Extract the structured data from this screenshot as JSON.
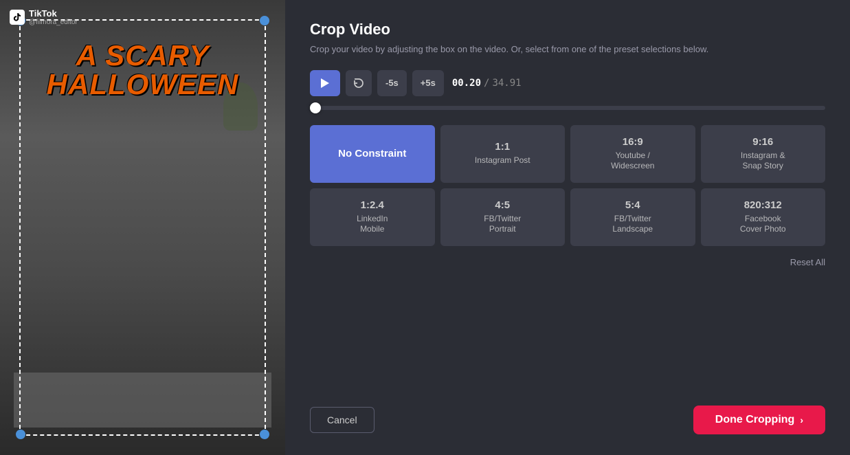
{
  "app": {
    "tiktok_name": "TikTok",
    "tiktok_handle": "@filmora_editor"
  },
  "halloween_title": "A SCARY",
  "halloween_subtitle": "HALLOWEEN",
  "panel": {
    "title": "Crop Video",
    "subtitle": "Crop your video by adjusting the box on the video. Or, select from one of the preset\nselections below."
  },
  "controls": {
    "minus5": "-5s",
    "plus5": "+5s",
    "current_time": "00.20",
    "separator": "/",
    "total_time": "34.91"
  },
  "presets": [
    {
      "ratio": "No Constraint",
      "label": "",
      "active": true
    },
    {
      "ratio": "1:1",
      "label": "Instagram Post",
      "active": false
    },
    {
      "ratio": "16:9",
      "label": "Youtube /\nWidescreen",
      "active": false
    },
    {
      "ratio": "9:16",
      "label": "Instagram &\nSnap Story",
      "active": false
    },
    {
      "ratio": "1:2.4",
      "label": "LinkedIn\nMobile",
      "active": false
    },
    {
      "ratio": "4:5",
      "label": "FB/Twitter\nPortrait",
      "active": false
    },
    {
      "ratio": "5:4",
      "label": "FB/Twitter\nLandscape",
      "active": false
    },
    {
      "ratio": "820:312",
      "label": "Facebook\nCover Photo",
      "active": false
    }
  ],
  "buttons": {
    "reset": "Reset All",
    "cancel": "Cancel",
    "done": "Done Cropping"
  }
}
